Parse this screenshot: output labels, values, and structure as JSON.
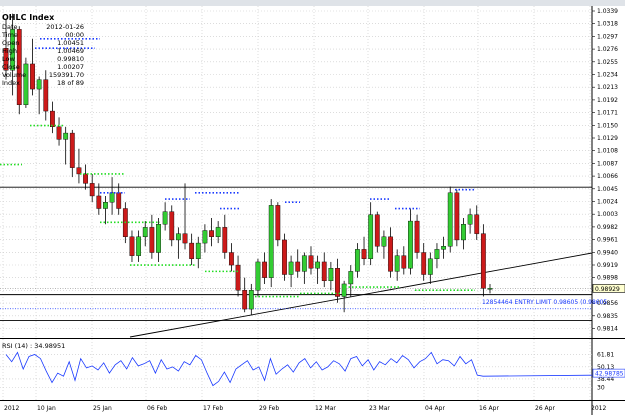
{
  "info": {
    "title": "OHLC Index",
    "rows": [
      {
        "label": "Date",
        "value": "2012-01-26"
      },
      {
        "label": "Time",
        "value": "00:00"
      },
      {
        "label": "Open",
        "value": "1.00451"
      },
      {
        "label": "High",
        "value": "1.00469"
      },
      {
        "label": "Low",
        "value": "0.99810"
      },
      {
        "label": "Close",
        "value": "1.00207"
      },
      {
        "label": "Volume",
        "value": "159391.70"
      },
      {
        "label": "Index",
        "value": "18 of 89"
      }
    ]
  },
  "price_axis_labels": [
    "1.0339",
    "1.0318",
    "1.0297",
    "1.0276",
    "1.0255",
    "1.0234",
    "1.0213",
    "1.0192",
    "1.0171",
    "1.0150",
    "1.0129",
    "1.0108",
    "1.0087",
    "1.0066",
    "1.0045",
    "1.0024",
    "1.0003",
    "0.9982",
    "0.9961",
    "0.9940",
    "0.9919",
    "0.9898",
    "0.9877",
    "0.9856",
    "0.9835",
    "0.9814"
  ],
  "current_price_label": "0.98929",
  "order_label": "12854464 ENTRY LIMIT 0.98605 (0.98605",
  "rsi": {
    "label": "RSI (14) : 34.98951",
    "levels": [
      "61.81",
      "50.13",
      "38.44",
      "30"
    ],
    "current": "42.98785",
    "values": [
      62,
      55,
      64,
      48,
      60,
      62,
      58,
      46,
      35,
      44,
      41,
      55,
      37,
      58,
      49,
      51,
      47,
      54,
      44,
      52,
      56,
      48,
      59,
      51,
      53,
      56,
      44,
      57,
      48,
      50,
      46,
      55,
      52,
      61,
      57,
      44,
      32,
      36,
      45,
      35,
      48,
      52,
      56,
      47,
      50,
      37,
      58,
      43,
      48,
      52,
      45,
      54,
      58,
      49,
      55,
      47,
      50,
      56,
      53,
      46,
      58,
      60,
      51,
      57,
      47,
      55,
      52,
      58,
      54,
      61,
      57,
      49,
      55,
      58,
      64,
      53,
      57,
      56,
      51,
      60,
      53,
      57,
      42,
      41
    ]
  },
  "date_labels": [
    "2012",
    "10 Jan",
    "25 Jan",
    "06 Feb",
    "17 Feb",
    "29 Feb",
    "12 Mar",
    "23 Mar",
    "04 Apr",
    "16 Apr",
    "26 Apr",
    "2012"
  ],
  "chart_data": {
    "type": "candlestick",
    "title": "OHLC Index",
    "ylim": [
      0.9814,
      1.0339
    ],
    "series": [
      {
        "name": "OHLC",
        "candles": [
          [
            1.0275,
            1.032,
            1.0225,
            1.024
          ],
          [
            1.024,
            1.033,
            1.02,
            1.0305
          ],
          [
            1.0305,
            1.031,
            1.017,
            1.0185
          ],
          [
            1.0185,
            1.026,
            1.018,
            1.025
          ],
          [
            1.025,
            1.029,
            1.02,
            1.021
          ],
          [
            1.021,
            1.023,
            1.017,
            1.0225
          ],
          [
            1.0225,
            1.024,
            1.016,
            1.0175
          ],
          [
            1.0175,
            1.019,
            1.014,
            1.015
          ],
          [
            1.015,
            1.0165,
            1.012,
            1.013
          ],
          [
            1.013,
            1.015,
            1.009,
            1.014
          ],
          [
            1.014,
            1.0145,
            1.007,
            1.0085
          ],
          [
            1.0085,
            1.0115,
            1.006,
            1.0075
          ],
          [
            1.0075,
            1.009,
            1.005,
            1.006
          ],
          [
            1.006,
            1.0075,
            1.003,
            1.004
          ],
          [
            1.004,
            1.006,
            1.001,
            1.002
          ],
          [
            1.002,
            1.004,
            0.9995,
            1.003
          ],
          [
            1.003,
            1.007,
            1.001,
            1.0045
          ],
          [
            1.0045,
            1.006,
            1.001,
            1.002
          ],
          [
            1.002,
            1.003,
            0.9965,
            0.9975
          ],
          [
            0.9975,
            0.9985,
            0.9935,
            0.9945
          ],
          [
            0.9945,
            0.9985,
            0.9935,
            0.9975
          ],
          [
            0.9975,
            1.0,
            0.996,
            0.999
          ],
          [
            0.999,
            1.001,
            0.994,
            0.995
          ],
          [
            0.995,
            1.0005,
            0.9935,
            0.9995
          ],
          [
            0.9995,
            1.003,
            0.9985,
            1.0015
          ],
          [
            1.0015,
            1.0025,
            0.996,
            0.997
          ],
          [
            0.997,
            0.999,
            0.994,
            0.998
          ],
          [
            0.998,
            1.006,
            0.9955,
            0.9965
          ],
          [
            0.9965,
            0.998,
            0.993,
            0.994
          ],
          [
            0.994,
            0.9975,
            0.9925,
            0.9965
          ],
          [
            0.9965,
            0.9995,
            0.995,
            0.9985
          ],
          [
            0.9985,
            1.0005,
            0.996,
            0.9975
          ],
          [
            0.9975,
            1.0,
            0.9965,
            0.999
          ],
          [
            0.999,
            1.001,
            0.994,
            0.995
          ],
          [
            0.995,
            0.9965,
            0.992,
            0.993
          ],
          [
            0.993,
            0.9945,
            0.988,
            0.989
          ],
          [
            0.989,
            0.991,
            0.9855,
            0.986
          ],
          [
            0.986,
            0.99,
            0.985,
            0.989
          ],
          [
            0.989,
            0.994,
            0.988,
            0.9935
          ],
          [
            0.9935,
            0.995,
            0.99,
            0.991
          ],
          [
            0.991,
            1.0035,
            0.9895,
            1.0025
          ],
          [
            1.0025,
            1.003,
            0.996,
            0.997
          ],
          [
            0.997,
            0.998,
            0.9905,
            0.9915
          ],
          [
            0.9915,
            0.9945,
            0.9895,
            0.9935
          ],
          [
            0.9935,
            0.9955,
            0.991,
            0.992
          ],
          [
            0.992,
            0.995,
            0.99,
            0.9945
          ],
          [
            0.9945,
            0.996,
            0.9915,
            0.9925
          ],
          [
            0.9925,
            0.9945,
            0.99,
            0.9935
          ],
          [
            0.9935,
            0.995,
            0.9895,
            0.9905
          ],
          [
            0.9905,
            0.9935,
            0.989,
            0.9925
          ],
          [
            0.9925,
            0.994,
            0.987,
            0.988
          ],
          [
            0.988,
            0.9905,
            0.9855,
            0.99
          ],
          [
            0.99,
            0.993,
            0.988,
            0.992
          ],
          [
            0.992,
            0.9965,
            0.991,
            0.9955
          ],
          [
            0.9955,
            0.9975,
            0.993,
            0.994
          ],
          [
            0.994,
            1.003,
            0.993,
            1.001
          ],
          [
            1.001,
            1.0015,
            0.995,
            0.996
          ],
          [
            0.996,
            0.9985,
            0.994,
            0.9975
          ],
          [
            0.9975,
            0.999,
            0.991,
            0.992
          ],
          [
            0.992,
            0.9955,
            0.9905,
            0.9945
          ],
          [
            0.9945,
            0.996,
            0.9915,
            0.9925
          ],
          [
            0.9925,
            1.002,
            0.9915,
            1.0
          ],
          [
            1.0,
            1.001,
            0.994,
            0.995
          ],
          [
            0.995,
            0.9965,
            0.9905,
            0.9915
          ],
          [
            0.9915,
            0.995,
            0.99,
            0.994
          ],
          [
            0.994,
            0.9965,
            0.9925,
            0.9955
          ],
          [
            0.9955,
            0.9975,
            0.994,
            0.996
          ],
          [
            0.996,
            1.0055,
            0.995,
            1.0045
          ],
          [
            1.0045,
            1.005,
            0.996,
            0.997
          ],
          [
            0.997,
            1.0005,
            0.9955,
            0.9995
          ],
          [
            0.9995,
            1.002,
            0.998,
            1.001
          ],
          [
            1.001,
            1.0025,
            0.997,
            0.998
          ],
          [
            0.998,
            0.9995,
            0.988,
            0.9893
          ],
          [
            0.9893,
            0.99,
            0.9885,
            0.9893
          ]
        ]
      },
      {
        "name": "Support dots (green)",
        "y": [
          1.0152,
          1.0152,
          1.0152,
          1.0152,
          1.0075,
          1.0075,
          1.0075,
          0.9998,
          0.9998,
          0.9998,
          0.9998,
          0.993,
          0.993,
          0.993,
          0.993,
          0.992,
          0.992,
          0.992,
          0.988,
          0.988,
          0.988,
          0.988,
          0.9885,
          0.9885,
          0.9885,
          0.9885,
          0.9895,
          0.9895,
          0.9895,
          0.9895,
          0.989,
          0.989,
          0.989,
          0.989
        ]
      },
      {
        "name": "Resistance dots (blue)",
        "y": [
          1.0275,
          1.0275,
          1.0275,
          1.0275,
          1.006,
          1.006,
          1.006,
          1.0045,
          1.0045,
          1.0045,
          1.0035,
          1.0035,
          1.0035,
          1.002,
          1.002,
          1.0025,
          1.0025,
          1.0025,
          1.0035,
          1.0035,
          1.0035,
          1.0025,
          1.0025,
          1.0025,
          1.002,
          1.002,
          1.002,
          1.005,
          1.005,
          1.005
        ]
      }
    ],
    "lines": {
      "resistance": 1.0054,
      "support": 0.9883,
      "lower": 0.9842,
      "order": 0.98605,
      "current": 0.98929
    },
    "grid": true
  }
}
